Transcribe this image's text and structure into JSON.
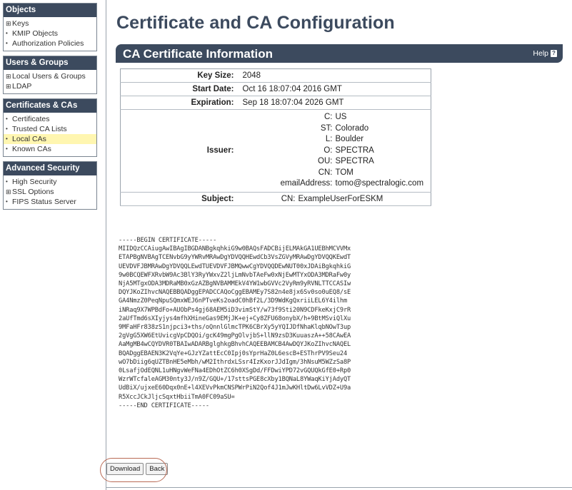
{
  "sidebar": {
    "sections": [
      {
        "title": "Objects",
        "items": [
          {
            "label": "Keys",
            "bullet": "⊞"
          },
          {
            "label": "KMIP Objects",
            "bullet": "•"
          },
          {
            "label": "Authorization Policies",
            "bullet": "•"
          }
        ]
      },
      {
        "title": "Users & Groups",
        "items": [
          {
            "label": "Local Users & Groups",
            "bullet": "⊞"
          },
          {
            "label": "LDAP",
            "bullet": "⊞"
          }
        ]
      },
      {
        "title": "Certificates & CAs",
        "items": [
          {
            "label": "Certificates",
            "bullet": "•"
          },
          {
            "label": "Trusted CA Lists",
            "bullet": "•"
          },
          {
            "label": "Local CAs",
            "bullet": "•"
          },
          {
            "label": "Known CAs",
            "bullet": "•"
          }
        ]
      },
      {
        "title": "Advanced Security",
        "items": [
          {
            "label": "High Security",
            "bullet": "•"
          },
          {
            "label": "SSL Options",
            "bullet": "⊞"
          },
          {
            "label": "FIPS Status Server",
            "bullet": "•"
          }
        ]
      }
    ]
  },
  "page_title": "Certificate and CA Configuration",
  "section": {
    "title": "CA Certificate Information",
    "help_label": "Help"
  },
  "info": {
    "key_size_label": "Key Size:",
    "key_size": "2048",
    "start_date_label": "Start Date:",
    "start_date": "Oct 16 18:07:04 2016 GMT",
    "expiration_label": "Expiration:",
    "expiration": "Sep 18 18:07:04 2026 GMT",
    "issuer_label": "Issuer:",
    "issuer": [
      {
        "k": "C:",
        "v": "US"
      },
      {
        "k": "ST:",
        "v": "Colorado"
      },
      {
        "k": "L:",
        "v": "Boulder"
      },
      {
        "k": "O:",
        "v": "SPECTRA"
      },
      {
        "k": "OU:",
        "v": "SPECTRA"
      },
      {
        "k": "CN:",
        "v": "TOM"
      },
      {
        "k": "emailAddress:",
        "v": "tomo@spectralogic.com"
      }
    ],
    "subject_label": "Subject:",
    "subject_key": "CN:",
    "subject_value": "ExampleUserForESKM"
  },
  "certificate_text": "-----BEGIN CERTIFICATE-----\nMIIDQzCCAiugAwIBAgIBGDANBgkqhkiG9w0BAQsFADCBijELMAkGA1UEBhMCVVMx\nETAPBgNVBAgTCENvbG9yYWRvMRAwDgYDVQQHEwdCb3VsZGVyMRAwDgYDVQQKEwdT\nUEVDVFJBMRAwDgYDVQQLEwdTUEVDVFJBMQwwCgYDVQQDEwNUT00xJDAiBgkqhkiG\n9w0BCQEWFXRvbW9Ac3BlY3RyYWxvZ2ljLmNvbTAeFw0xNjEwMTYxODA3MDRaFw0y\nNjA5MTgxODA3MDRaMB0xGzAZBgNVBAMMEkV4YW1wbGVVc2VyRm9yRVNLTTCCASIw\nDQYJKoZIhvcNAQEBBQADggEPADCCAQoCggEBAMEy7S82n4e8jx6Sv0so0uEQ8/sE\nGA4NmzZ0PeqNpuSQmxWEJ6nPTveKs2oadC0hBf2L/3D9WdKgQxriiLEL6Y4ilhm\niNRaq9X7WPBdFo+AUObPs4gj68AEM5iD3vimStY/w73f9Sti20N9CDFkeKxjC9rR\n2aUfTmd6sXIyjys4mfhXHineGas9EMjJK+ej+Cy8ZFU68onybX/h+9BtMSviQlXu\n9MFaHFr838zS1njpci3+ths/oQnnlGlmcTPK6CBrXy5yYQIJDfNhaKlqbNOwT3up\n2gVgG5XW6EtUvicgVpCDQOi/gcK49mgPgOlvjbS+llN9zsD3KuuaszA++58CAwEA\nAaMgMB4wCQYDVR0TBAIwADARBglghkgBhvhCAQEEBAMCB4AwDQYJKoZIhvcNAQEL\nBQADggEBAEN3K2VqYe+GJzYZattEcC0Ipj0sYprHaZ0L6escB+ESThrPV9Seu24\nwO7bDiig6qUZTBnHE5eMbh/wM2IthrdxLSsr4IzKxorJJdIgm/3hNsuM5WZzSa8P\n0LsafjOdEQNL1uHNgvWeFNa4EDhOtZC6h0XSgDd/FFDwiYPD72vGQUQkGfE0+Rp0\nWzrWTcfaleAGM30nty3J/n9Z/GQU+/17sttsPGE8cXby1BQNaL8YWaqKiYjAdyQT\nUdBiX/ujxeE60Dqx0nE+l4XEVvPkmCNSPWrPiN2Qof4J1mJwKHltDw6LvVDZ+U9a\nR5XccJCkJljcSqxtHbiiTmA0FC09aSU=\n-----END CERTIFICATE-----",
  "buttons": {
    "download": "Download",
    "back": "Back"
  }
}
